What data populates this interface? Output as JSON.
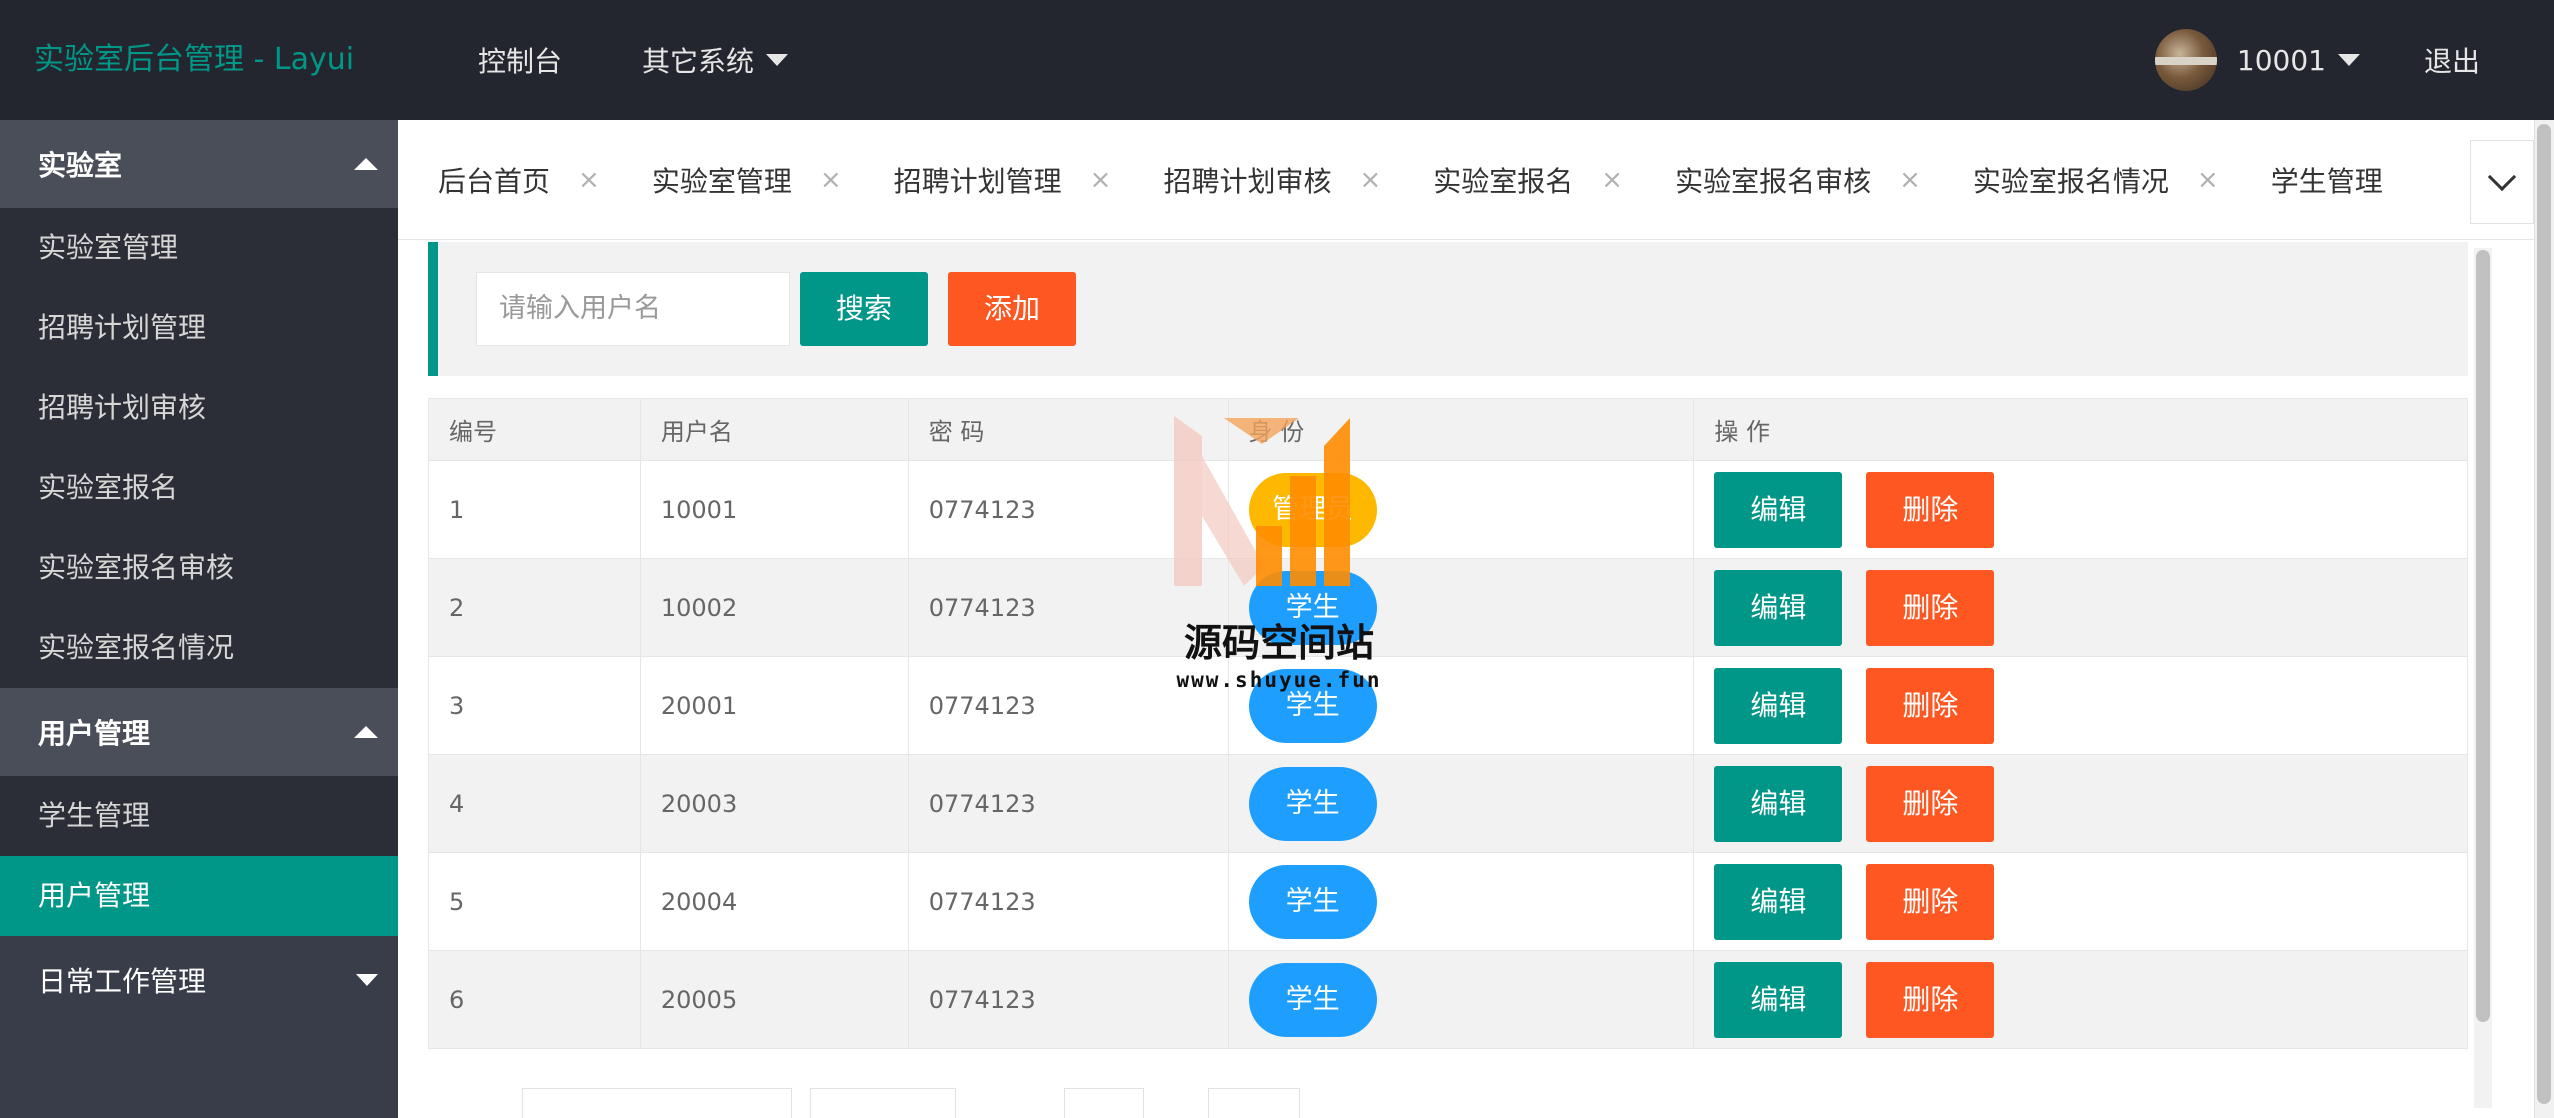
{
  "header": {
    "logo": "实验室后台管理 - Layui",
    "nav": [
      "控制台",
      "其它系统"
    ],
    "user": "10001",
    "logout": "退出"
  },
  "sidebar": {
    "group1": {
      "title": "实验室",
      "items": [
        "实验室管理",
        "招聘计划管理",
        "招聘计划审核",
        "实验室报名",
        "实验室报名审核",
        "实验室报名情况"
      ]
    },
    "group2": {
      "title": "用户管理",
      "items": [
        "学生管理",
        "用户管理"
      ],
      "active": "用户管理"
    },
    "group3": {
      "title": "日常工作管理"
    }
  },
  "tabs": [
    "后台首页",
    "实验室管理",
    "招聘计划管理",
    "招聘计划审核",
    "实验室报名",
    "实验室报名审核",
    "实验室报名情况",
    "学生管理"
  ],
  "tab_close": "×",
  "search": {
    "placeholder": "请输入用户名",
    "search_label": "搜索",
    "add_label": "添加"
  },
  "table": {
    "headers": [
      "编号",
      "用户名",
      "密 码",
      "身 份",
      "操 作"
    ],
    "rows": [
      {
        "id": "1",
        "username": "10001",
        "password": "0774123",
        "role": "管理员"
      },
      {
        "id": "2",
        "username": "10002",
        "password": "0774123",
        "role": "学生"
      },
      {
        "id": "3",
        "username": "20001",
        "password": "0774123",
        "role": "学生"
      },
      {
        "id": "4",
        "username": "20003",
        "password": "0774123",
        "role": "学生"
      },
      {
        "id": "5",
        "username": "20004",
        "password": "0774123",
        "role": "学生"
      },
      {
        "id": "6",
        "username": "20005",
        "password": "0774123",
        "role": "学生"
      }
    ],
    "edit_label": "编辑",
    "delete_label": "删除"
  },
  "watermark": {
    "title": "源码空间站",
    "url": "www.shuyue.fun"
  },
  "colors": {
    "primary": "#009688",
    "danger": "#ff5722",
    "info": "#1e9fff",
    "warn": "#ffb800",
    "header_bg": "#23262e",
    "sidebar_bg": "#393d49"
  }
}
